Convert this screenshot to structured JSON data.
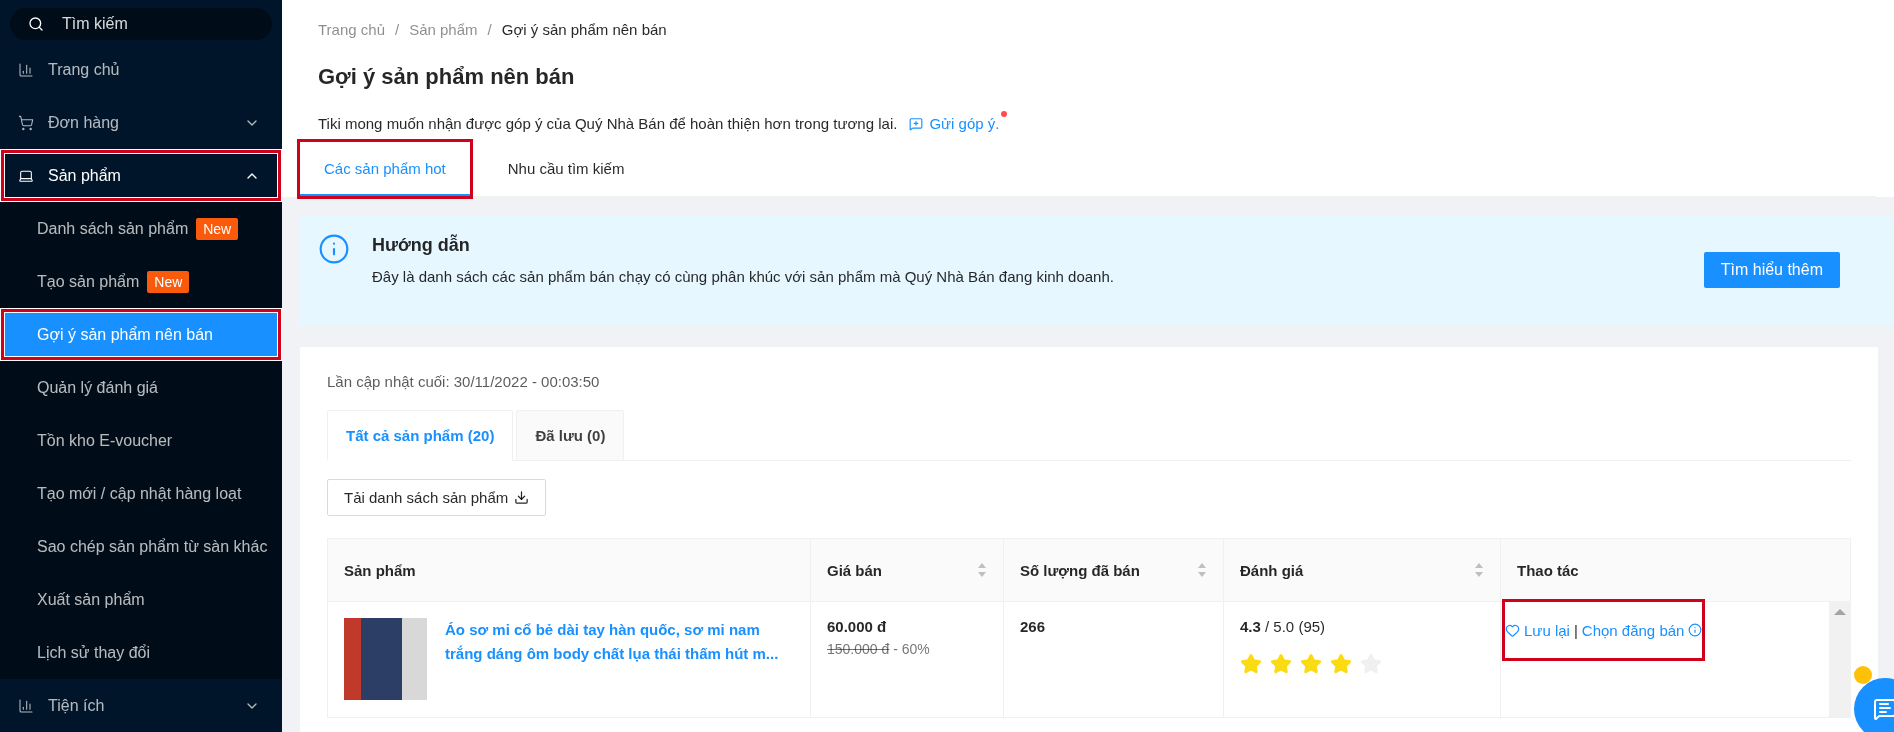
{
  "sidebar": {
    "search": {
      "placeholder": "Tìm kiếm"
    },
    "items": [
      {
        "kind": "link",
        "label": "Trang chủ"
      },
      {
        "kind": "group",
        "label": "Đơn hàng",
        "expanded": false,
        "highlighted": false
      },
      {
        "kind": "group",
        "label": "Sản phẩm",
        "expanded": true,
        "highlighted": true,
        "children": [
          {
            "label": "Danh sách sản phẩm",
            "badge": "New",
            "selected": false,
            "highlighted": false
          },
          {
            "label": "Tạo sản phẩm",
            "badge": "New",
            "selected": false,
            "highlighted": false
          },
          {
            "label": "Gợi ý sản phẩm nên bán",
            "selected": true,
            "highlighted": true
          },
          {
            "label": "Quản lý đánh giá",
            "selected": false,
            "highlighted": false
          },
          {
            "label": "Tồn kho E-voucher",
            "selected": false,
            "highlighted": false
          },
          {
            "label": "Tạo mới / cập nhật hàng loạt",
            "selected": false,
            "highlighted": false
          },
          {
            "label": "Sao chép sản phẩm từ sàn khác",
            "selected": false,
            "highlighted": false
          },
          {
            "label": "Xuất sản phẩm",
            "selected": false,
            "highlighted": false
          },
          {
            "label": "Lịch sử thay đổi",
            "selected": false,
            "highlighted": false
          }
        ]
      },
      {
        "kind": "group",
        "label": "Tiện ích",
        "expanded": false,
        "highlighted": false
      }
    ]
  },
  "breadcrumb": [
    {
      "label": "Trang chủ",
      "separator": "/"
    },
    {
      "label": "Sản phẩm",
      "separator": "/"
    },
    {
      "label": "Gợi ý sản phẩm nên bán"
    }
  ],
  "title": "Gợi ý sản phẩm nên bán",
  "description": "Tiki mong muốn nhận được góp ý của Quý Nhà Bán để hoàn thiện hơn trong tương lai.",
  "feedback_link": {
    "label": "Gửi góp ý.",
    "unread": true
  },
  "page_tabs": [
    {
      "label": "Các sản phẩm hot",
      "selected": true,
      "highlighted": true
    },
    {
      "label": "Nhu cầu tìm kiếm",
      "selected": false,
      "highlighted": false
    }
  ],
  "guide": {
    "title": "Hướng dẫn",
    "text": "Đây là danh sách các sản phẩm bán chạy có cùng phân khúc với sản phẩm mà Quý Nhà Bán đang kinh doanh.",
    "button": "Tìm hiểu thêm"
  },
  "card": {
    "updated": "Lần cập nhật cuối: 30/11/2022 - 00:03:50",
    "tabs": [
      {
        "label": "Tất cả sản phẩm (20)",
        "selected": true
      },
      {
        "label": "Đã lưu (0)",
        "selected": false
      }
    ],
    "download_button": "Tải danh sách sản phẩm",
    "table": {
      "columns": [
        {
          "label": "Sản phẩm",
          "sortable": false
        },
        {
          "label": "Giá bán",
          "sortable": true
        },
        {
          "label": "Số lượng đã bán",
          "sortable": true
        },
        {
          "label": "Đánh giá",
          "sortable": true
        },
        {
          "label": "Thao tác",
          "sortable": false
        }
      ],
      "rows": [
        {
          "product": "Áo sơ mi cổ bẻ dài tay hàn quốc, sơ mi nam trắng dáng ôm body chất lụa thái thấm hút m...",
          "price": "60.000 đ",
          "old_price": "150.000 đ",
          "discount": "- 60%",
          "sold": "266",
          "rating": "**4.3** / 5.0 (95)",
          "stars": 4,
          "save": "Lưu lại",
          "separator": "|",
          "choose": "Chọn đăng bán",
          "highlighted": true
        }
      ]
    }
  }
}
